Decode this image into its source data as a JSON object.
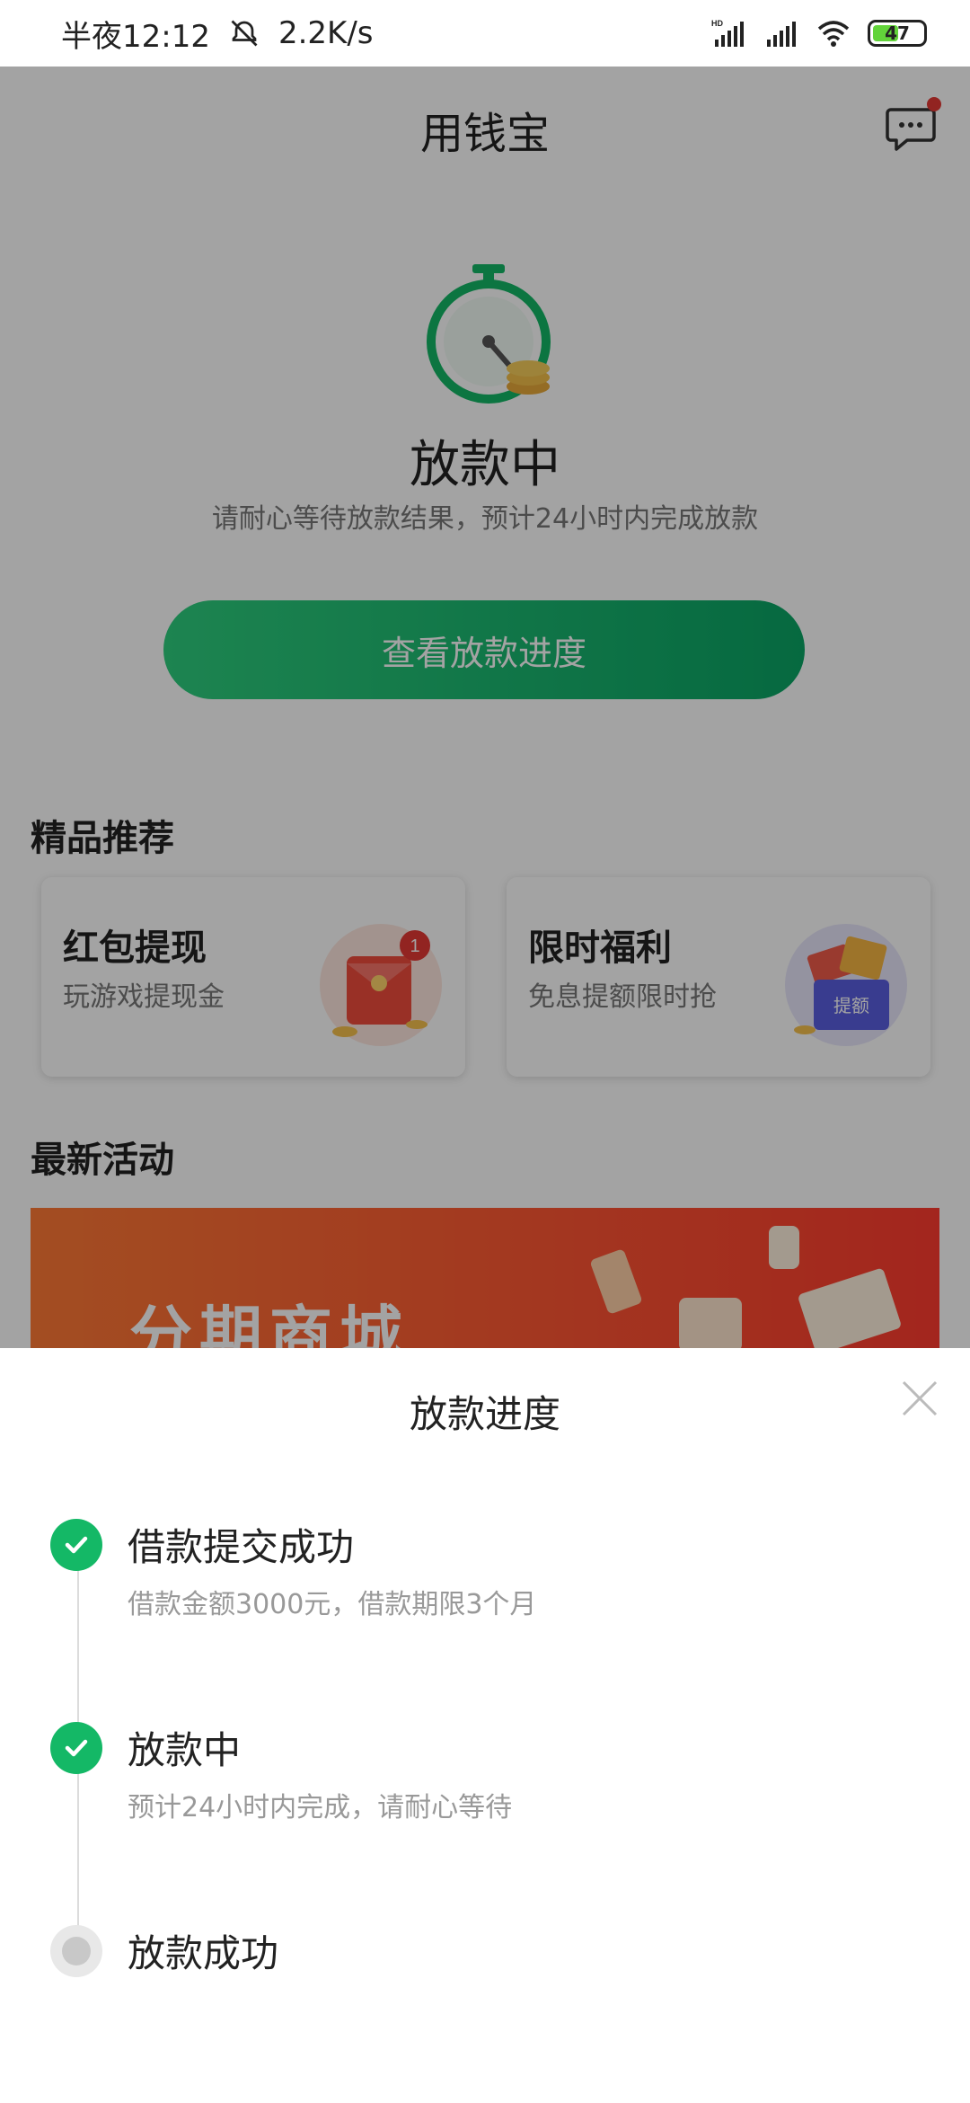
{
  "status_bar": {
    "time": "半夜12:12",
    "net_speed": "2.2K/s",
    "battery": "47"
  },
  "header": {
    "title": "用钱宝"
  },
  "status_card": {
    "title": "放款中",
    "subtitle": "请耐心等待放款结果，预计24小时内完成放款",
    "button_label": "查看放款进度"
  },
  "recommend": {
    "section_title": "精品推荐",
    "cards": [
      {
        "title": "红包提现",
        "subtitle": "玩游戏提现金",
        "badge": "1"
      },
      {
        "title": "限时福利",
        "subtitle": "免息提额限时抢",
        "tag": "提额"
      }
    ]
  },
  "activities": {
    "section_title": "最新活动",
    "banner_text": "分期商城"
  },
  "progress_sheet": {
    "title": "放款进度",
    "steps": [
      {
        "title": "借款提交成功",
        "desc": "借款金额3000元，借款期限3个月",
        "status": "done"
      },
      {
        "title": "放款中",
        "desc": "预计24小时内完成，请耐心等待",
        "status": "done"
      },
      {
        "title": "放款成功",
        "desc": "",
        "status": "pending"
      }
    ]
  },
  "colors": {
    "accent_green": "#14b866",
    "badge_red": "#e53935"
  }
}
